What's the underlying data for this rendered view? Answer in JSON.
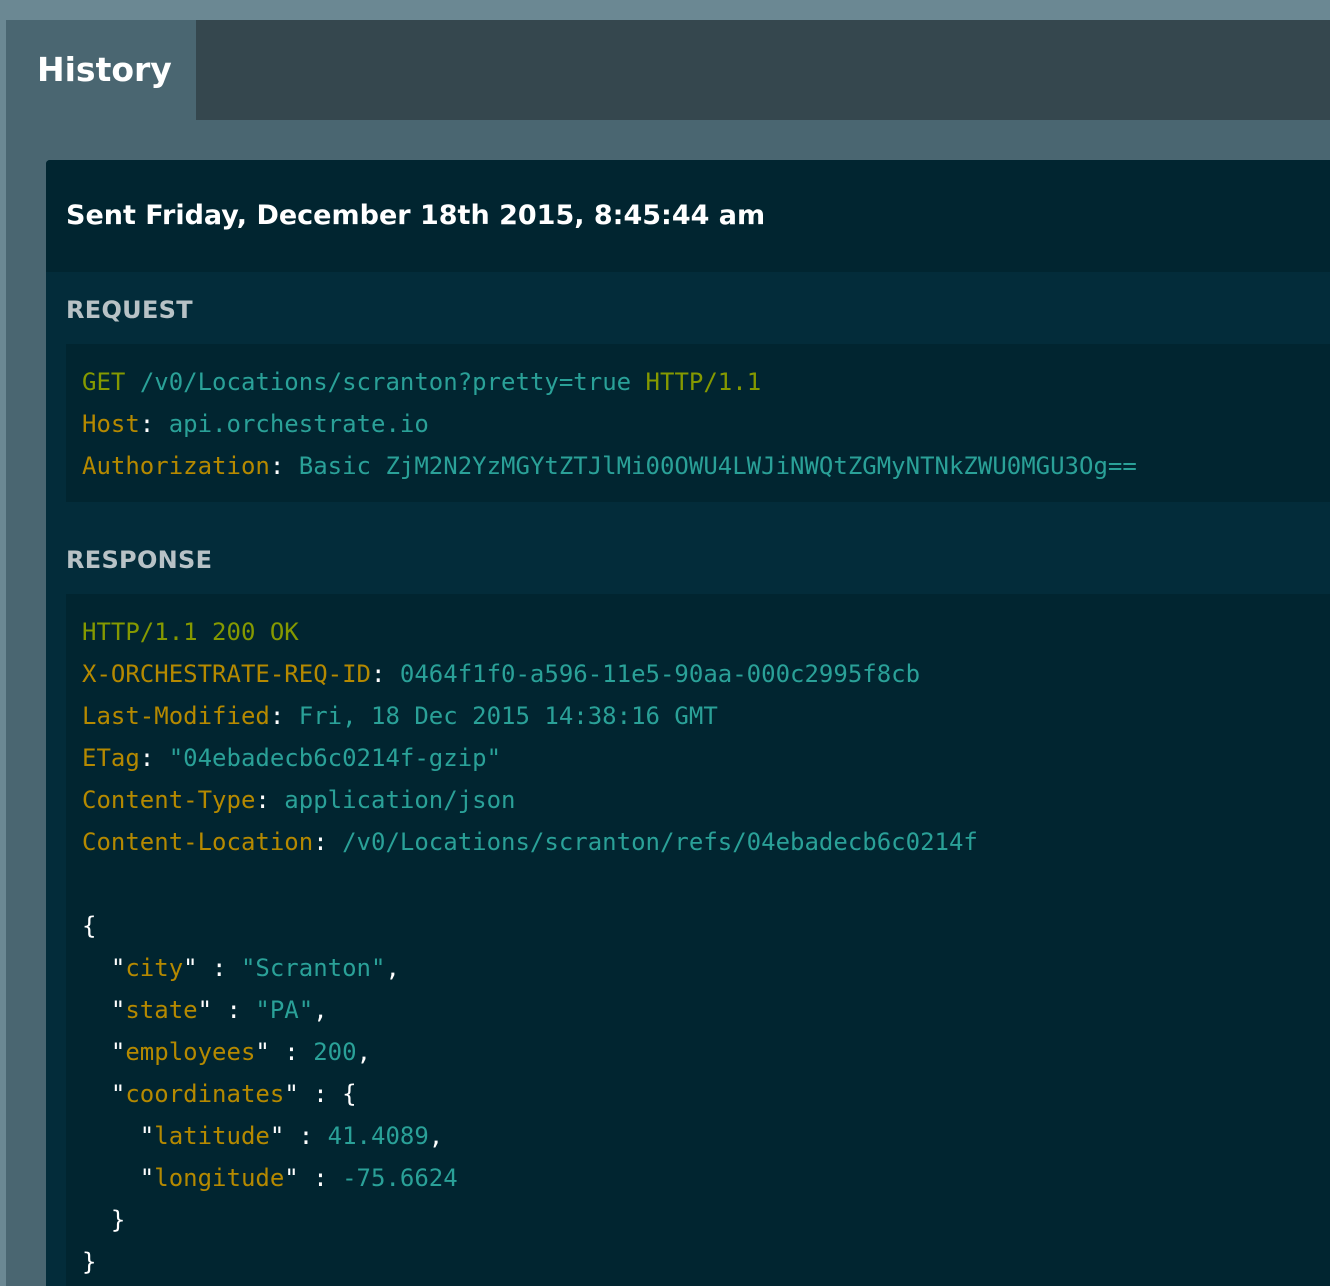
{
  "tabs": {
    "active_label": "History"
  },
  "entry": {
    "sent_label": "Sent Friday, December 18th 2015, 8:45:44 am"
  },
  "request": {
    "section_title": "REQUEST",
    "method": "GET",
    "path": "/v0/Locations/scranton?pretty=true",
    "protocol": "HTTP/1.1",
    "headers": [
      {
        "name": "Host",
        "value": "api.orchestrate.io"
      },
      {
        "name": "Authorization",
        "value": "Basic ZjM2N2YzMGYtZTJlMi00OWU4LWJiNWQtZGMyNTNkZWU0MGU3Og=="
      }
    ]
  },
  "response": {
    "section_title": "RESPONSE",
    "status_line": "HTTP/1.1 200 OK",
    "headers": [
      {
        "name": "X-ORCHESTRATE-REQ-ID",
        "value": "0464f1f0-a596-11e5-90aa-000c2995f8cb"
      },
      {
        "name": "Last-Modified",
        "value": "Fri, 18 Dec 2015 14:38:16 GMT"
      },
      {
        "name": "ETag",
        "value": "\"04ebadecb6c0214f-gzip\""
      },
      {
        "name": "Content-Type",
        "value": "application/json"
      },
      {
        "name": "Content-Location",
        "value": "/v0/Locations/scranton/refs/04ebadecb6c0214f"
      }
    ],
    "body": {
      "city_key": "city",
      "city_value": "\"Scranton\"",
      "state_key": "state",
      "state_value": "\"PA\"",
      "employees_key": "employees",
      "employees_value": "200",
      "coordinates_key": "coordinates",
      "latitude_key": "latitude",
      "latitude_value": "41.4089",
      "longitude_key": "longitude",
      "longitude_value": "-75.6624"
    }
  },
  "colors": {
    "keyword": "#859900",
    "header_name": "#b58900",
    "value": "#2aa198",
    "panel_bg": "#012632"
  }
}
